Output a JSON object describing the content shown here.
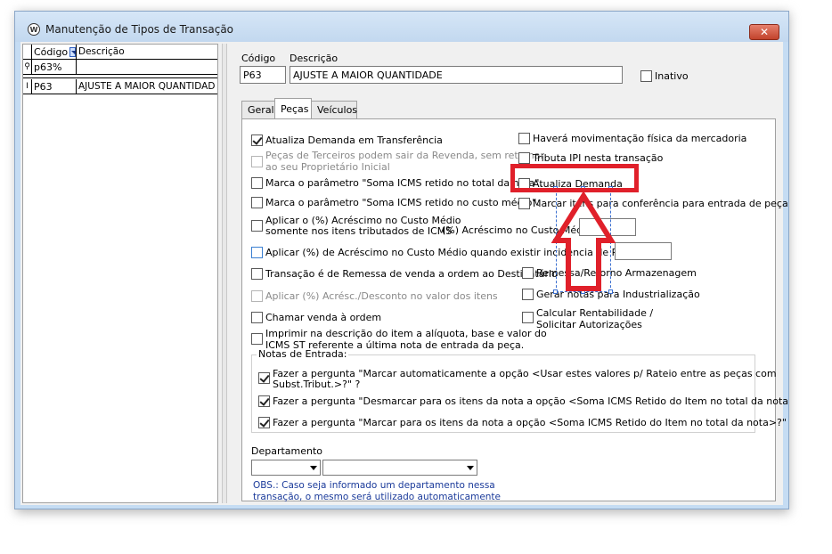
{
  "window": {
    "title": "Manutenção de Tipos de Transação",
    "close": "✕"
  },
  "grid": {
    "headers": {
      "code": "Código",
      "desc": "Descrição"
    },
    "filter_value": "p63%",
    "rows": [
      {
        "code": "P63",
        "desc": "AJUSTE A MAIOR QUANTIDAD"
      }
    ]
  },
  "form": {
    "code_label": "Código",
    "desc_label": "Descrição",
    "code_value": "P63",
    "desc_value": "AJUSTE A MAIOR QUANTIDADE",
    "inactive_label": "Inativo"
  },
  "tabs": [
    "Geral",
    "Peças",
    "Veículos"
  ],
  "active_tab": "Peças",
  "left_options": {
    "atualiza_transf": "Atualiza Demanda em Transferência",
    "pecas_terceiros_1": "Peças de Terceiros podem sair da Revenda, sem retornar",
    "pecas_terceiros_2": "ao seu Proprietário Inicial",
    "marca_total": "Marca o parâmetro \"Soma ICMS retido no total da nota\".",
    "marca_custo": "Marca o parâmetro \"Soma ICMS retido no custo médio\".",
    "aplicar_1": "Aplicar o (%) Acréscimo no Custo Médio",
    "aplicar_2": "somente nos itens tributados de ICMS",
    "acrescimo_label": "(%) Acréscimo no Custo Médio:",
    "aplicar_pis": "Aplicar (%) de Acréscimo no Custo Médio quando existir incidência de Pis/Cofins:",
    "remessa_venda": "Transação é de Remessa de venda a ordem ao Destinatário",
    "aplicar_acresc": "Aplicar (%) Acrésc./Desconto no valor dos itens",
    "chamar_venda": "Chamar venda à ordem",
    "imprimir_1": "Imprimir na descrição do item a alíquota, base e valor do",
    "imprimir_2": "ICMS ST referente a última nota de entrada da peça."
  },
  "right_options": {
    "movimentacao": "Haverá movimentação física da mercadoria",
    "tributa_ipi": "Tributa IPI nesta transação",
    "atualiza_demanda": "Atualiza Demanda",
    "marcar_itens": "Marcar itens para conferência para entrada de peças",
    "remessa_retorno": "Remessa/Retorno Armazenagem",
    "gerar_notas": "Gerar notas para Industrialização",
    "calc_1": "Calcular Rentabilidade /",
    "calc_2": "Solicitar Autorizações"
  },
  "notas_entrada": {
    "title": "Notas de Entrada:",
    "q1_a": "Fazer a pergunta \"Marcar automaticamente a opção <Usar estes valores p/ Rateio entre as peças com",
    "q1_b": "Subst.Tribut.>?\" ?",
    "q2": "Fazer a pergunta \"Desmarcar para os itens da nota a opção <Soma ICMS Retido do Item no total da nota>?\" ?",
    "q3": "Fazer a pergunta \"Marcar para os itens da nota a opção <Soma ICMS Retido do Item no total da nota>?\" ?"
  },
  "departamento": {
    "label": "Departamento",
    "obs_1": "OBS.: Caso seja informado um departamento nessa",
    "obs_2": "transação, o mesmo será utilizado automaticamente"
  },
  "colors": {
    "highlight": "#e0202a",
    "selection": "#3a6fd0",
    "obs_text": "#1a3a9a"
  }
}
